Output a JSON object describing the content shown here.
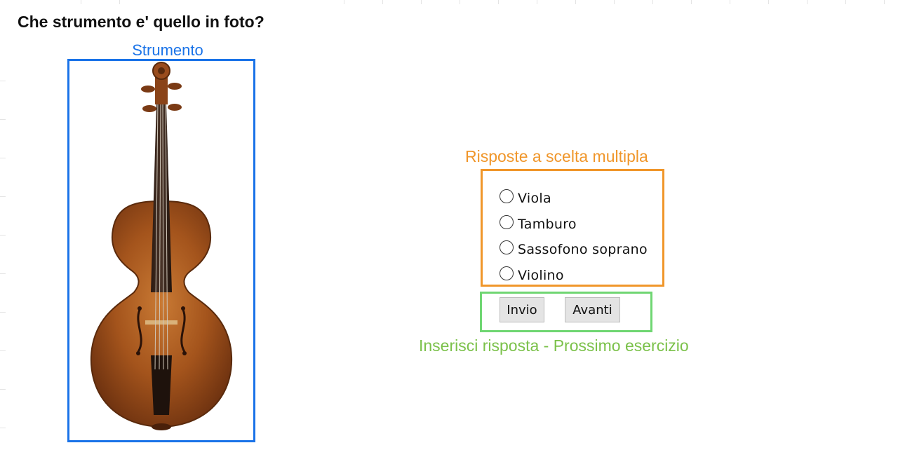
{
  "question": "Che strumento e' quello in foto?",
  "image_section": {
    "label": "Strumento"
  },
  "choices_section": {
    "label": "Risposte a scelta multipla",
    "options": [
      "Viola",
      "Tamburo",
      "Sassofono soprano",
      "Violino"
    ]
  },
  "buttons_section": {
    "submit_label": "Invio",
    "next_label": "Avanti",
    "caption": "Inserisci risposta - Prossimo esercizio"
  },
  "colors": {
    "image_box": "#1a73e8",
    "choices_box": "#f0962a",
    "buttons_box": "#6fd672",
    "buttons_caption": "#7bc14a"
  }
}
